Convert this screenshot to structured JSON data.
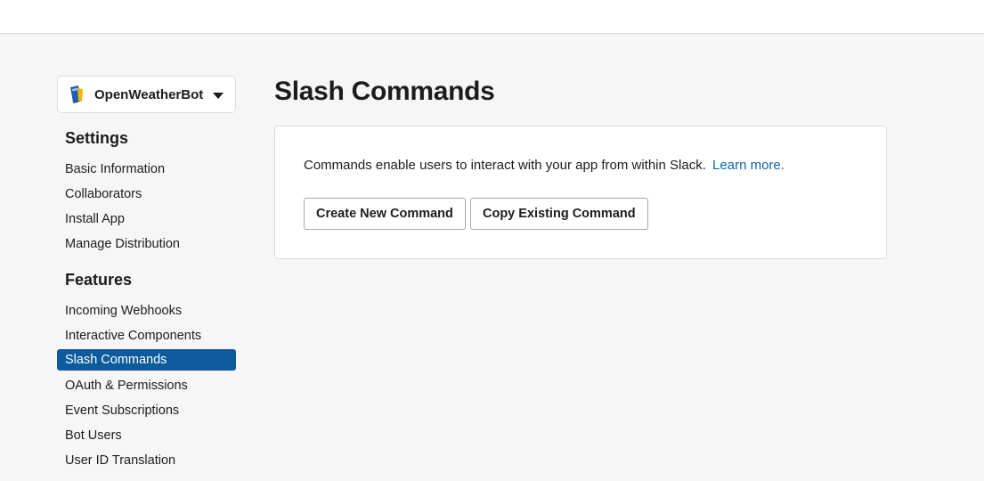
{
  "app_switcher": {
    "app_name": "OpenWeatherBot",
    "icon": "book-icon"
  },
  "sidebar": {
    "settings": {
      "title": "Settings",
      "items": [
        {
          "label": "Basic Information"
        },
        {
          "label": "Collaborators"
        },
        {
          "label": "Install App"
        },
        {
          "label": "Manage Distribution"
        }
      ]
    },
    "features": {
      "title": "Features",
      "items": [
        {
          "label": "Incoming Webhooks"
        },
        {
          "label": "Interactive Components"
        },
        {
          "label": "Slash Commands",
          "active": true
        },
        {
          "label": "OAuth & Permissions"
        },
        {
          "label": "Event Subscriptions"
        },
        {
          "label": "Bot Users"
        },
        {
          "label": "User ID Translation"
        }
      ]
    }
  },
  "main": {
    "title": "Slash Commands",
    "card": {
      "description": "Commands enable users to interact with your app from within Slack.",
      "learn_more": "Learn more.",
      "create_button": "Create New Command",
      "copy_button": "Copy Existing Command"
    }
  },
  "colors": {
    "active_nav": "#0d5a9c",
    "link": "#1264a3",
    "background": "#f6f6f6"
  }
}
